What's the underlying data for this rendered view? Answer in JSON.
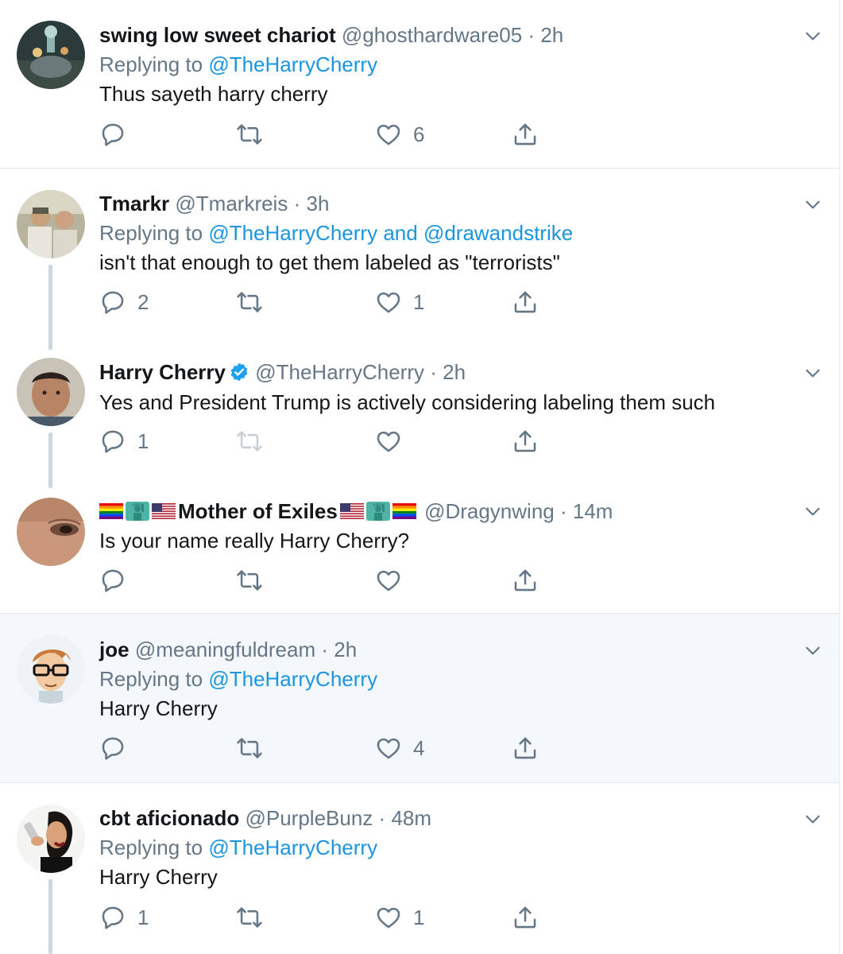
{
  "colors": {
    "link": "#1b95e0",
    "muted": "#657786",
    "text": "#14171a",
    "highlight_bg": "#f5f8fa",
    "verified": "#1da1f2"
  },
  "tweets": [
    {
      "name": "swing low sweet chariot",
      "handle": "@ghosthardware05",
      "dot": "·",
      "time": "2h",
      "replying_prefix": "Replying to",
      "replying_to": "@TheHarryCherry",
      "text": "Thus sayeth harry cherry",
      "reply_count": "",
      "retweet_count": "",
      "like_count": "6"
    },
    {
      "name": "Tmarkr",
      "handle": "@Tmarkreis",
      "dot": "·",
      "time": "3h",
      "replying_prefix": "Replying to",
      "replying_to": "@TheHarryCherry",
      "replying_and": "and",
      "replying_to_2": "@drawandstrike",
      "text": "isn't that enough to get them labeled as \"terrorists\"",
      "reply_count": "2",
      "retweet_count": "",
      "like_count": "1"
    },
    {
      "name": "Harry Cherry",
      "verified": true,
      "handle": "@TheHarryCherry",
      "dot": "·",
      "time": "2h",
      "text": "Yes and President Trump is actively considering labeling them such",
      "reply_count": "1",
      "retweet_count": "",
      "like_count": ""
    },
    {
      "name": "Mother of Exiles",
      "name_emoji_prefix": [
        "rainbow-flag",
        "statue-of-liberty",
        "us-flag"
      ],
      "name_emoji_suffix": [
        "us-flag",
        "statue-of-liberty",
        "rainbow-flag"
      ],
      "handle": "@Dragynwing",
      "dot": "·",
      "time": "14m",
      "text": "Is your name really Harry Cherry?",
      "reply_count": "",
      "retweet_count": "",
      "like_count": ""
    },
    {
      "name": "joe",
      "handle": "@meaningfuldream",
      "dot": "·",
      "time": "2h",
      "replying_prefix": "Replying to",
      "replying_to": "@TheHarryCherry",
      "text": "Harry Cherry",
      "reply_count": "",
      "retweet_count": "",
      "like_count": "4"
    },
    {
      "name": "cbt aficionado",
      "handle": "@PurpleBunz",
      "dot": "·",
      "time": "48m",
      "replying_prefix": "Replying to",
      "replying_to": "@TheHarryCherry",
      "text": "Harry Cherry",
      "reply_count": "1",
      "retweet_count": "",
      "like_count": "1"
    }
  ]
}
